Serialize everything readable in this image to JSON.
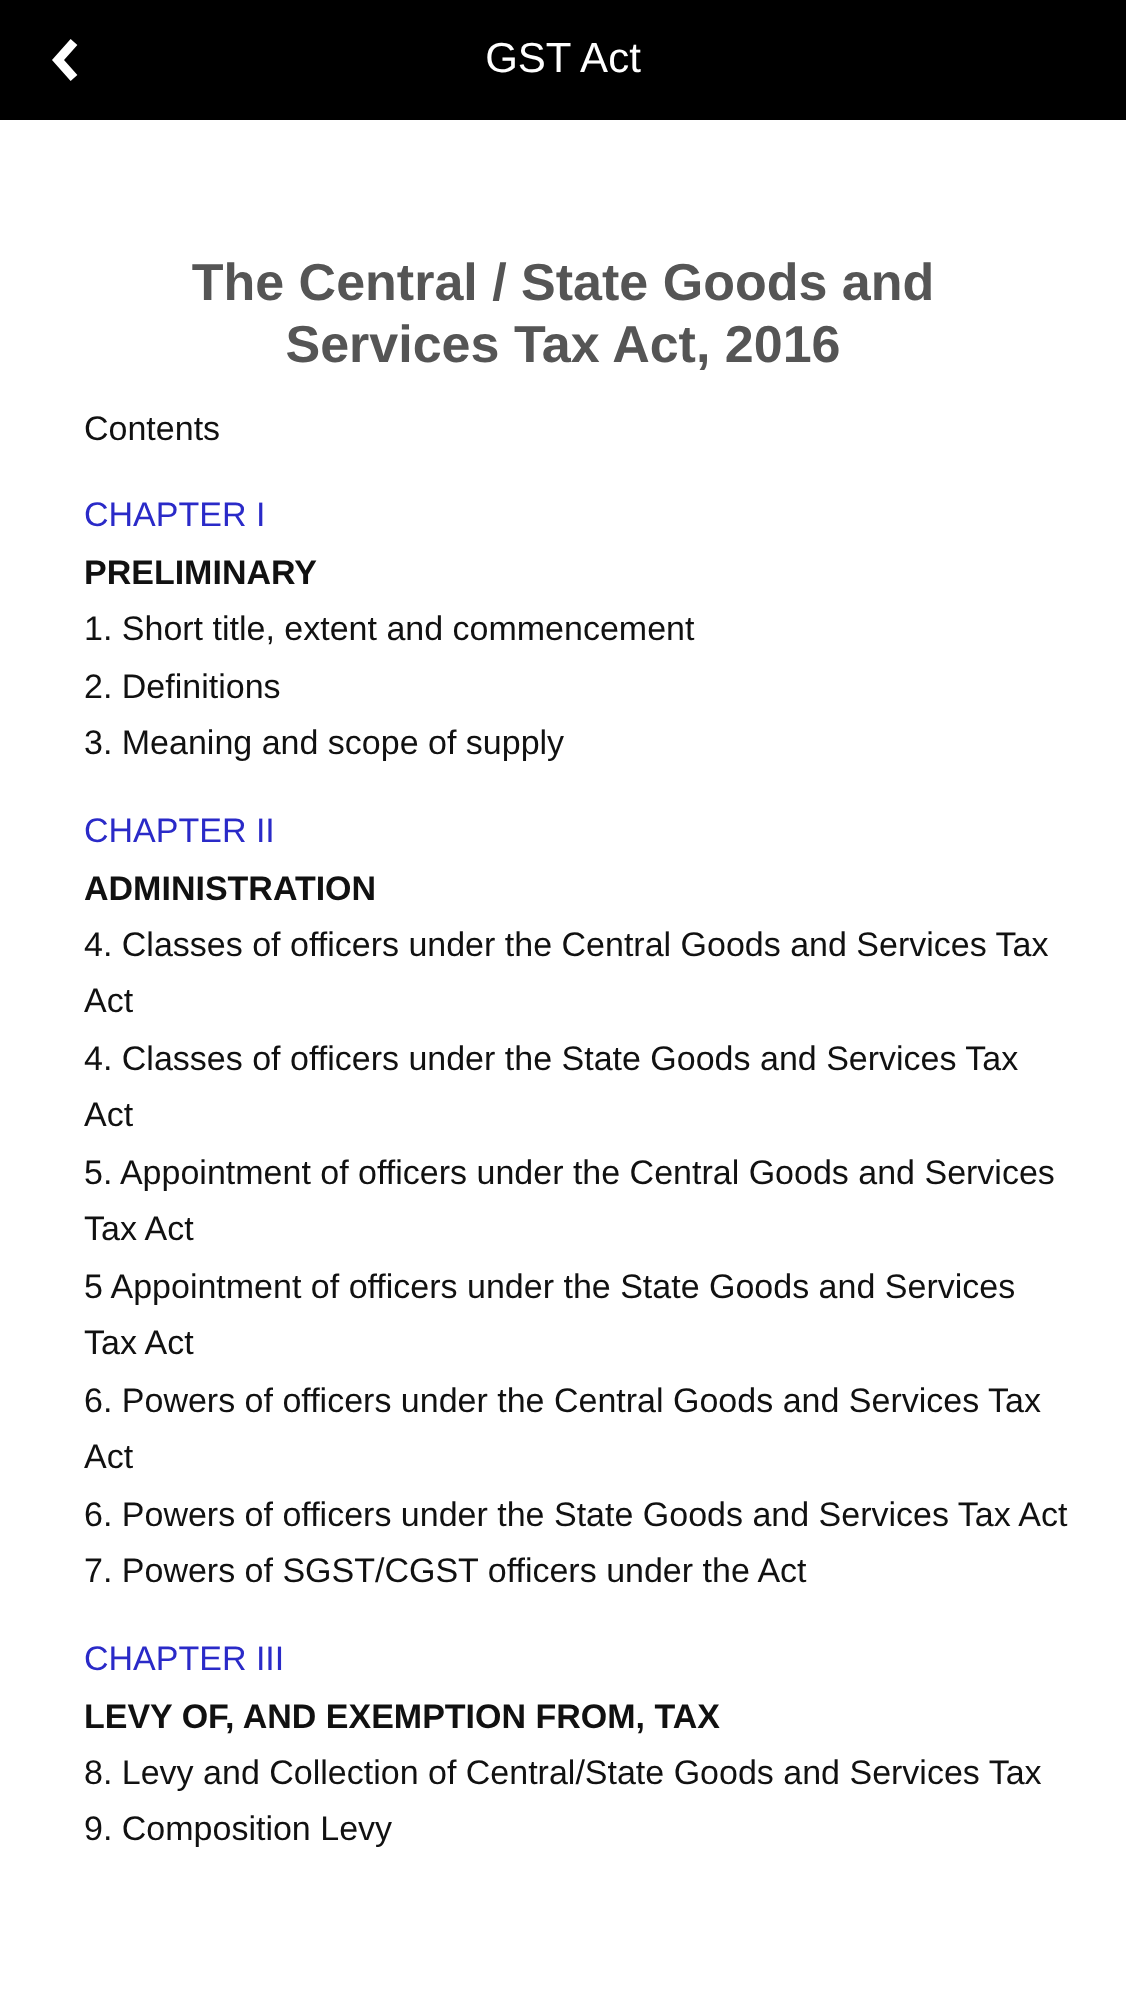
{
  "nav_bar": {
    "title": "GST Act"
  },
  "document": {
    "title": "The Central / State Goods and Services Tax Act, 2016",
    "contents_label": "Contents",
    "chapters": [
      {
        "link": "CHAPTER I",
        "heading": "PRELIMINARY",
        "sections": [
          "1. Short title, extent and commencement",
          "2. Definitions",
          "3. Meaning and scope of supply"
        ]
      },
      {
        "link": "CHAPTER II",
        "heading": "ADMINISTRATION",
        "sections": [
          "4. Classes of officers under the Central Goods and Services Tax Act",
          "4. Classes of officers under the State Goods and Services Tax Act",
          "5. Appointment of officers under the Central Goods and Services Tax Act",
          "5 Appointment of officers under the State Goods and Services Tax Act",
          "6. Powers of officers under the Central Goods and Services Tax Act",
          "6. Powers of officers under the State Goods and Services Tax Act",
          "7. Powers of SGST/CGST officers under the Act"
        ]
      },
      {
        "link": "CHAPTER III",
        "heading": "LEVY OF, AND EXEMPTION FROM, TAX",
        "sections": [
          "8. Levy and Collection of Central/State Goods and Services Tax",
          "9. Composition Levy"
        ]
      }
    ]
  }
}
